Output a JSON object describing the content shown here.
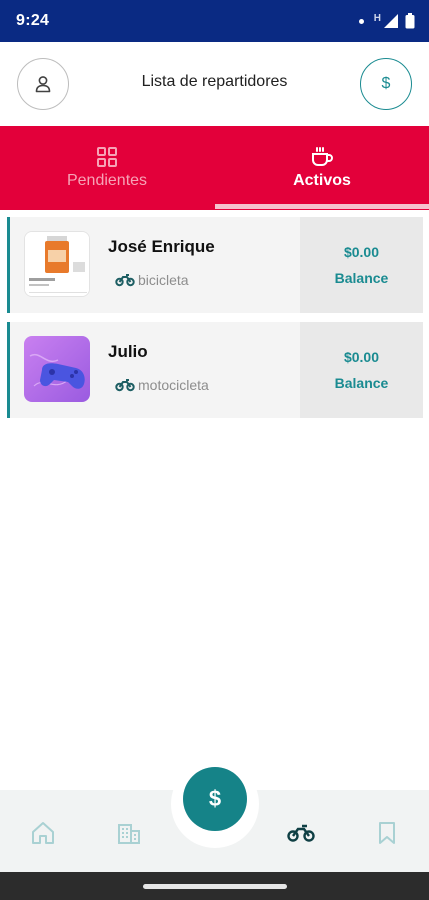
{
  "status_bar": {
    "time": "9:24",
    "network_letter": "H"
  },
  "header": {
    "title": "Lista de repartidores"
  },
  "tabs": [
    {
      "label": "Pendientes",
      "icon": "grid-icon",
      "active": false
    },
    {
      "label": "Activos",
      "icon": "coffee-cup-icon",
      "active": true
    }
  ],
  "couriers": [
    {
      "name": "José Enrique",
      "vehicle": "bicicleta",
      "vehicle_icon": "motorcycle-icon",
      "amount": "$0.00",
      "balance_label": "Balance",
      "thumbnail": "product-image"
    },
    {
      "name": "Julio",
      "vehicle": "motocicleta",
      "vehicle_icon": "motorcycle-icon",
      "amount": "$0.00",
      "balance_label": "Balance",
      "thumbnail": "game-controller-image"
    }
  ],
  "bottom_nav": {
    "items": [
      "home-icon",
      "building-icon",
      "motorcycle-icon",
      "bookmark-icon"
    ],
    "active": "motorcycle-icon",
    "fab_symbol": "$"
  },
  "colors": {
    "status_bar": "#0a2a83",
    "tab_bar": "#e3003a",
    "accent_teal": "#1a8b91",
    "fab": "#158388"
  }
}
